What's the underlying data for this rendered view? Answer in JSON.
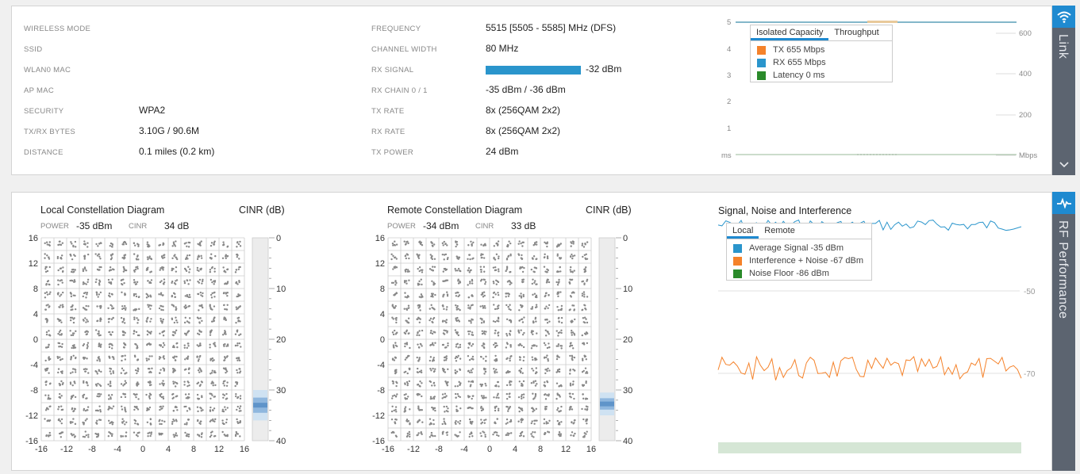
{
  "link": {
    "sidebar_label": "Link",
    "fields_left": [
      {
        "label": "WIRELESS MODE",
        "value": ""
      },
      {
        "label": "SSID",
        "value": ""
      },
      {
        "label": "WLAN0 MAC",
        "value": ""
      },
      {
        "label": "AP MAC",
        "value": ""
      },
      {
        "label": "SECURITY",
        "value": "WPA2"
      },
      {
        "label": "TX/RX BYTES",
        "value": "3.10G / 90.6M"
      },
      {
        "label": "DISTANCE",
        "value": "0.1 miles (0.2 km)"
      }
    ],
    "fields_right": [
      {
        "label": "FREQUENCY",
        "value": "5515 [5505 - 5585] MHz (DFS)"
      },
      {
        "label": "CHANNEL WIDTH",
        "value": "80 MHz"
      },
      {
        "label": "RX SIGNAL",
        "value": "-32 dBm"
      },
      {
        "label": "RX CHAIN 0 / 1",
        "value": "-35 dBm / -36 dBm"
      },
      {
        "label": "TX RATE",
        "value": "8x (256QAM 2x2)"
      },
      {
        "label": "RX RATE",
        "value": "8x (256QAM 2x2)"
      },
      {
        "label": "TX POWER",
        "value": "24 dBm"
      }
    ],
    "capacity_chart": {
      "left_ticks": [
        "5",
        "4",
        "3",
        "2",
        "1",
        "ms"
      ],
      "right_ticks": [
        "600",
        "400",
        "200",
        "Mbps"
      ],
      "tabs": [
        "Isolated Capacity",
        "Throughput"
      ],
      "legend": [
        {
          "label": "TX 655 Mbps",
          "color": "#f5822a"
        },
        {
          "label": "RX 655 Mbps",
          "color": "#2a95cc"
        },
        {
          "label": "Latency 0 ms",
          "color": "#2a8a2a"
        }
      ]
    }
  },
  "rf": {
    "sidebar_label": "RF Performance",
    "local": {
      "title": "Local Constellation Diagram",
      "cinr_title": "CINR (dB)",
      "power_label": "POWER",
      "power_value": "-35 dBm",
      "cinr_label": "CINR",
      "cinr_value": "34 dB"
    },
    "remote": {
      "title": "Remote Constellation Diagram",
      "cinr_title": "CINR (dB)",
      "power_label": "POWER",
      "power_value": "-34 dBm",
      "cinr_label": "CINR",
      "cinr_value": "33 dB"
    },
    "axis_ticks": [
      "16",
      "12",
      "8",
      "4",
      "0",
      "-4",
      "-8",
      "-12",
      "-16"
    ],
    "x_ticks": [
      "-16",
      "-12",
      "-8",
      "-4",
      "0",
      "4",
      "8",
      "12",
      "16"
    ],
    "cinr_ticks": [
      "0",
      "10",
      "20",
      "30",
      "40"
    ],
    "sni": {
      "title": "Signal, Noise and Interference",
      "tabs": [
        "Local",
        "Remote"
      ],
      "legend": [
        {
          "label": "Average Signal -35 dBm",
          "color": "#2a95cc"
        },
        {
          "label": "Interference + Noise -67 dBm",
          "color": "#f5822a"
        },
        {
          "label": "Noise Floor -86 dBm",
          "color": "#2a8a2a"
        }
      ],
      "right_ticks": [
        "-50",
        "-70"
      ]
    }
  }
}
